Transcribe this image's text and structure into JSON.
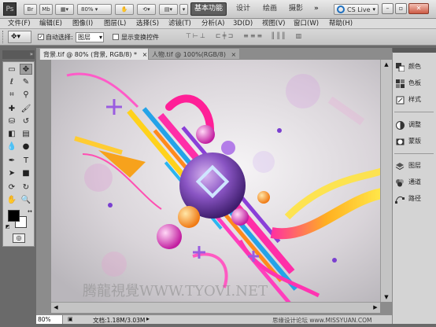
{
  "appbar": {
    "logo": "Ps",
    "bridge": "Br",
    "minibridge": "Mb",
    "zoom": "80%",
    "workspaces": [
      "基本功能",
      "设计",
      "绘画",
      "摄影"
    ],
    "workspace_more": "»",
    "cslive": "CS Live"
  },
  "menu": [
    "文件(F)",
    "编辑(E)",
    "图像(I)",
    "图层(L)",
    "选择(S)",
    "滤镜(T)",
    "分析(A)",
    "3D(D)",
    "视图(V)",
    "窗口(W)",
    "帮助(H)"
  ],
  "options": {
    "auto_select_label": "自动选择:",
    "auto_select_value": "图层",
    "show_transform_label": "显示变换控件"
  },
  "tabs": [
    {
      "label": "背景.tif @ 80% (背景, RGB/8) *",
      "close": "×"
    },
    {
      "label": "人物.tif @ 100%(RGB/8)",
      "close": "×"
    }
  ],
  "status": {
    "zoom": "80%",
    "doc_info": "文档:1.18M/3.03M"
  },
  "watermark": "腾龍視覺WWW.TYOVI.NET",
  "footer_watermark": "思缘设计论坛  www.MISSYUAN.COM",
  "panels": [
    {
      "label": "颜色",
      "icon": "color-swatch-icon"
    },
    {
      "label": "色板",
      "icon": "swatches-grid-icon"
    },
    {
      "label": "样式",
      "icon": "styles-icon"
    },
    {
      "label": "调整",
      "icon": "adjustment-icon"
    },
    {
      "label": "蒙版",
      "icon": "mask-icon"
    },
    {
      "label": "图层",
      "icon": "layers-icon"
    },
    {
      "label": "通道",
      "icon": "channels-icon"
    },
    {
      "label": "路径",
      "icon": "paths-icon"
    }
  ],
  "colors": {
    "foreground": "#000000",
    "background": "#ffffff",
    "active_workspace": "#5e5e5e"
  }
}
